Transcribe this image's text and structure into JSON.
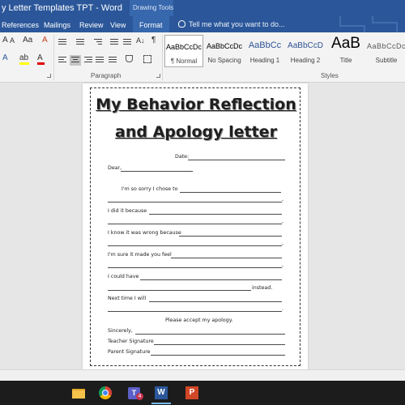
{
  "window": {
    "title": "y Letter Templates TPT - Word",
    "contextual_tab_group": "Drawing Tools"
  },
  "tabs": {
    "references": "References",
    "mailings": "Mailings",
    "review": "Review",
    "view": "View",
    "format": "Format",
    "tell_me": "Tell me what you want to do..."
  },
  "ribbon": {
    "font_grow": "A",
    "font_shrink": "A",
    "change_case": "Aa",
    "clear_format": "A",
    "text_effects": "A",
    "highlight": "ab",
    "font_color": "A",
    "show_marks": "¶",
    "sort": "A↓",
    "paragraph_label": "Paragraph",
    "styles_label": "Styles",
    "accent_color": "#2b579a"
  },
  "styles": [
    {
      "sample": "AaBbCcDc",
      "name": "¶ Normal",
      "selected": true
    },
    {
      "sample": "AaBbCcDc",
      "name": "No Spacing",
      "selected": false
    },
    {
      "sample": "AaBbCc",
      "name": "Heading 1",
      "selected": false
    },
    {
      "sample": "AaBbCcD",
      "name": "Heading 2",
      "selected": false
    },
    {
      "sample": "AaB",
      "name": "Title",
      "selected": false
    },
    {
      "sample": "AaBbCcDc",
      "name": "Subtitle",
      "selected": false
    }
  ],
  "document": {
    "heading_line1": "My Behavior Reflection",
    "heading_line2": "and Apology letter",
    "date": "Date:",
    "dear": "Dear,",
    "sorry": "I'm so sorry I chose to",
    "comma1": ",",
    "did_it": "I did it because",
    "comma2": ",",
    "knew_wrong": "I know it was wrong because",
    "comma3": ",",
    "made_feel": "I'm sure it made you feel",
    "comma4": ",",
    "could_have": "I could have",
    "instead": "instead.",
    "next_time": "Next time I will",
    "period": ".",
    "accept": "Please accept my apology.",
    "sincerely": "Sincerely,",
    "teacher_sig": "Teacher Signature",
    "parent_sig": "Parent Signature"
  },
  "taskbar": {
    "teams_badge": "4",
    "word_letter": "W",
    "ppt_letter": "P"
  }
}
